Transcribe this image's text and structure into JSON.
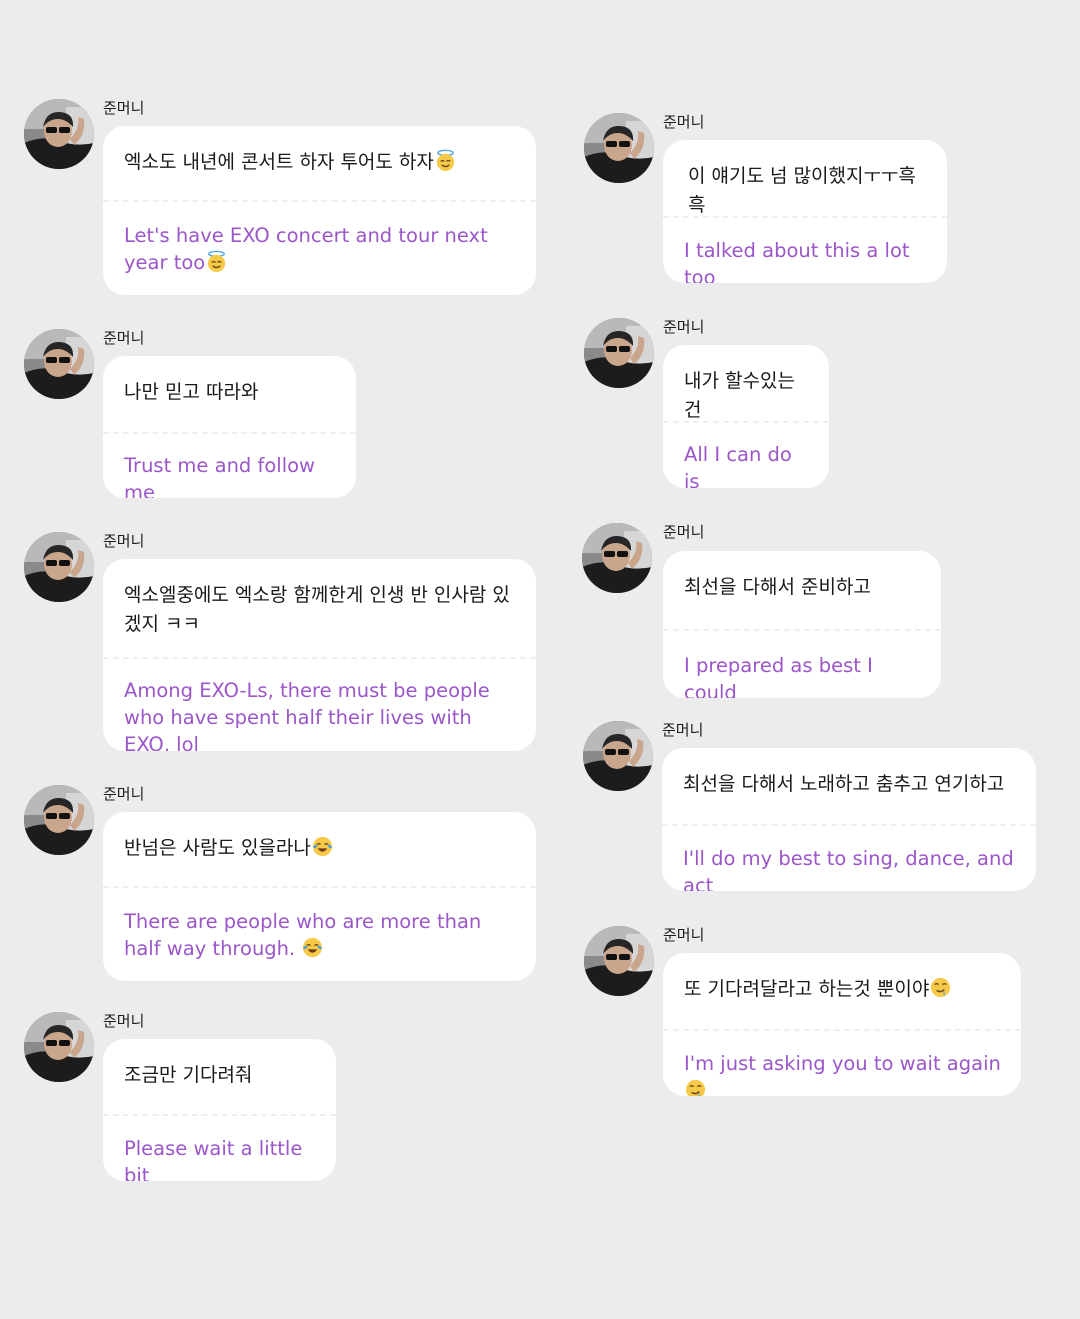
{
  "messages": [
    {
      "sender": "준머니",
      "korean": "엑소도 내년에 콘서트 하자 투어도 하자",
      "english": "Let's have EXO concert and tour next year too",
      "emoji_korean": "halo-face",
      "emoji_english": "halo-face"
    },
    {
      "sender": "준머니",
      "korean": "나만 믿고 따라와",
      "english": "Trust me and follow me"
    },
    {
      "sender": "준머니",
      "korean": "엑소엘중에도 엑소랑 함께한게 인생 반 인사람 있겠지 ㅋㅋ",
      "english": "Among EXO-Ls, there must be people who have spent half their lives with EXO, lol"
    },
    {
      "sender": "준머니",
      "korean": "반넘은 사람도 있을라나",
      "english": "There are people who are more than half way through. ",
      "emoji_korean": "tears-of-joy-face",
      "emoji_english": "tears-of-joy-face"
    },
    {
      "sender": "준머니",
      "korean": "조금만 기다려줘",
      "english": "Please wait a little bit"
    },
    {
      "sender": "준머니",
      "korean": "이 얘기도 넘 많이했지ㅜㅜ흑흑",
      "english": "I talked about this a lot too"
    },
    {
      "sender": "준머니",
      "korean": "내가 할수있는건",
      "english": "All I can do is"
    },
    {
      "sender": "준머니",
      "korean": "최선을 다해서 준비하고",
      "english": "I prepared as best I could"
    },
    {
      "sender": "준머니",
      "korean": "최선을 다해서 노래하고 춤추고 연기하고",
      "english": "I'll do my best to sing, dance, and act"
    },
    {
      "sender": "준머니",
      "korean": "또 기다려달라고 하는것 뿐이야",
      "english": "I'm just asking you to wait again ",
      "emoji_korean": "drooling-face",
      "emoji_english": "drooling-face"
    }
  ],
  "colors": {
    "background": "#ececec",
    "bubble": "#ffffff",
    "english_text": "#9b57c9",
    "korean_text": "#1a1a1a"
  }
}
